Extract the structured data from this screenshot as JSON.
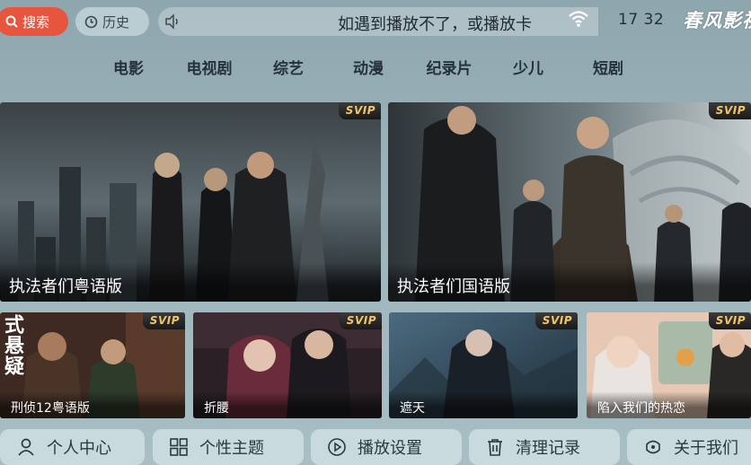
{
  "topbar": {
    "search_label": "搜索",
    "history_label": "历史",
    "marquee_text": "如遇到播放不了，或播放卡",
    "clock": "17 32",
    "brand": "春风影视"
  },
  "nav": {
    "tabs": [
      {
        "label": "电影"
      },
      {
        "label": "电视剧"
      },
      {
        "label": "综艺"
      },
      {
        "label": "动漫"
      },
      {
        "label": "纪录片"
      },
      {
        "label": "少儿"
      },
      {
        "label": "短剧"
      }
    ]
  },
  "featured": [
    {
      "title": "执法者们粤语版",
      "badge": "SVIP"
    },
    {
      "title": "执法者们国语版",
      "badge": "SVIP"
    }
  ],
  "row2": [
    {
      "title": "刑侦12粤语版",
      "badge": "SVIP",
      "poster_text": "式悬疑"
    },
    {
      "title": "折腰",
      "badge": "SVIP"
    },
    {
      "title": "遮天",
      "badge": "SVIP"
    },
    {
      "title": "陷入我们的热恋",
      "badge": "SVIP"
    }
  ],
  "bottom": [
    {
      "label": "个人中心",
      "icon": "person-icon"
    },
    {
      "label": "个性主题",
      "icon": "grid-icon"
    },
    {
      "label": "播放设置",
      "icon": "play-circle-icon"
    },
    {
      "label": "清理记录",
      "icon": "trash-icon"
    },
    {
      "label": "关于我们",
      "icon": "info-icon"
    }
  ],
  "colors": {
    "accent": "#e8553f",
    "background": "#9bb3ba",
    "svip_text": "#f2c46b"
  }
}
